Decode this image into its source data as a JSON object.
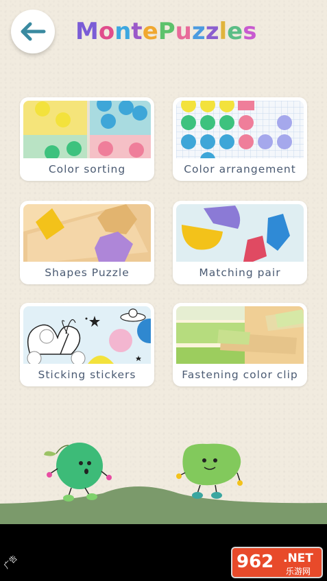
{
  "header": {
    "back_icon": "arrow-left-icon",
    "title_part1": "Monte",
    "title_part2": "Puzzles",
    "title_colors": [
      "#7a5cd6",
      "#e04c8c",
      "#3da7e0",
      "#9b59c9",
      "#f0a830",
      "#5cc26b",
      "#e86a9a",
      "#4b9be0",
      "#8b5fcf",
      "#e0b43c",
      "#5bbd86",
      "#c85ad0"
    ]
  },
  "cards": [
    {
      "label": "Color sorting",
      "icon": "color-sorting-thumbnail"
    },
    {
      "label": "Color arrangement",
      "icon": "color-arrangement-thumbnail"
    },
    {
      "label": "Shapes Puzzle",
      "icon": "shapes-puzzle-thumbnail"
    },
    {
      "label": "Matching pair",
      "icon": "matching-pair-thumbnail"
    },
    {
      "label": "Sticking stickers",
      "icon": "sticking-stickers-thumbnail"
    },
    {
      "label": "Fastening color clip",
      "icon": "fastening-color-clip-thumbnail"
    }
  ],
  "footer": {
    "ad_label": "广告",
    "watermark_main": "962",
    "watermark_suffix": ".NET",
    "watermark_sub": "乐游网"
  },
  "colors": {
    "background": "#f1ebdf",
    "label_text": "#4a5a72",
    "back_arrow": "#3a8aa0",
    "ground": "#7b9a6b"
  }
}
